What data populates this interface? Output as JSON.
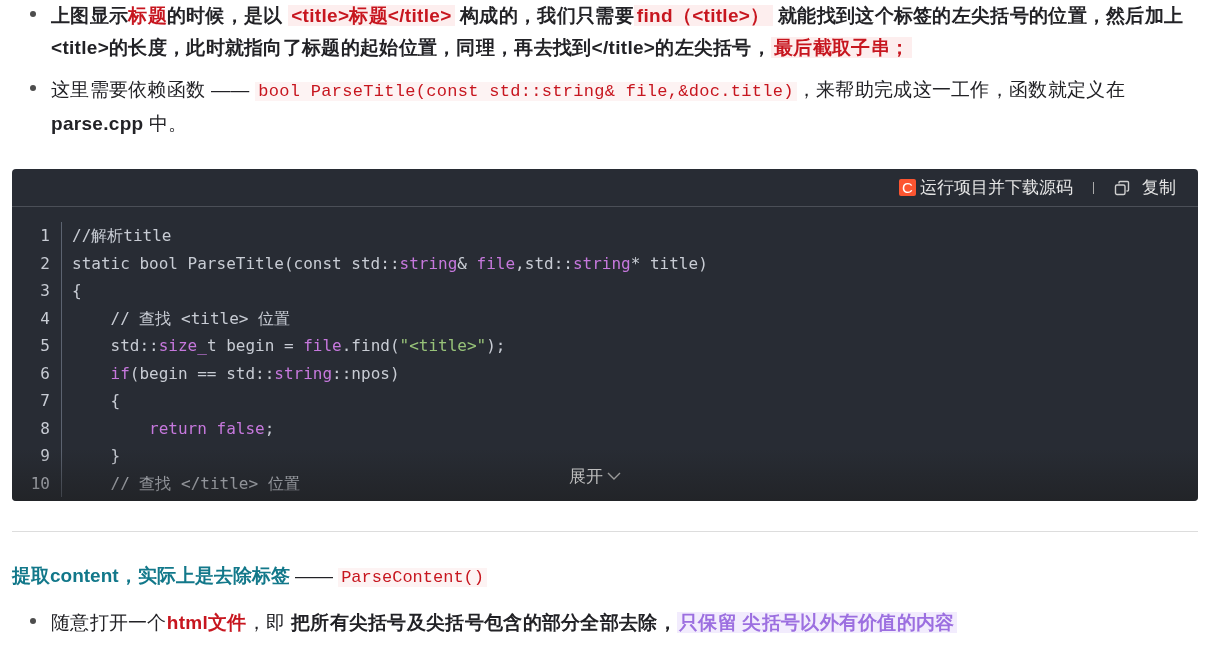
{
  "bullets_top": [
    {
      "segments": [
        {
          "kind": "bold",
          "text": "上图显示"
        },
        {
          "kind": "red",
          "text": "标题"
        },
        {
          "kind": "bold",
          "text": "的时候，是以 "
        },
        {
          "kind": "mark",
          "text": "<title>标题</title>"
        },
        {
          "kind": "bold",
          "text": " 构成的，我们只需要"
        },
        {
          "kind": "mark",
          "text": "find（<title>）"
        },
        {
          "kind": "bold",
          "text": " 就能找到这个标签的左尖括号的位置，然后加上<title>的长度，此时就指向了标题的起始位置，同理，再去找到</title>的左尖括号，"
        },
        {
          "kind": "mark",
          "text": "最后截取子串； "
        }
      ]
    },
    {
      "segments": [
        {
          "kind": "plain",
          "text": "这里需要依赖函数 —— "
        },
        {
          "kind": "code",
          "text": "bool ParseTitle(const std::string& file,&doc.title)"
        },
        {
          "kind": "plain",
          "text": "，来帮助完成这一工作，函数就定义在 "
        },
        {
          "kind": "bold",
          "text": "parse.cpp"
        },
        {
          "kind": "plain",
          "text": " 中。"
        }
      ]
    }
  ],
  "code_block": {
    "logo": "C",
    "run_button": "运行项目并下载源码",
    "copy_button": "复制",
    "expand_button": "展开",
    "lines": [
      {
        "number": "1",
        "tokens": [
          {
            "kind": "plain",
            "text": "//解析title"
          }
        ]
      },
      {
        "number": "2",
        "tokens": [
          {
            "kind": "plain",
            "text": "static bool ParseTitle(const std::"
          },
          {
            "kind": "keyword",
            "text": "string"
          },
          {
            "kind": "plain",
            "text": "& "
          },
          {
            "kind": "keyword",
            "text": "file"
          },
          {
            "kind": "plain",
            "text": ",std::"
          },
          {
            "kind": "keyword",
            "text": "string"
          },
          {
            "kind": "plain",
            "text": "* title)"
          }
        ]
      },
      {
        "number": "3",
        "tokens": [
          {
            "kind": "plain",
            "text": "{"
          }
        ]
      },
      {
        "number": "4",
        "tokens": [
          {
            "kind": "plain",
            "text": "    // 查找 <title> 位置"
          }
        ]
      },
      {
        "number": "5",
        "tokens": [
          {
            "kind": "plain",
            "text": "    std::"
          },
          {
            "kind": "keyword",
            "text": "size_"
          },
          {
            "kind": "plain",
            "text": "t begin = "
          },
          {
            "kind": "keyword",
            "text": "file"
          },
          {
            "kind": "plain",
            "text": ".find("
          },
          {
            "kind": "string",
            "text": "\"<title>\""
          },
          {
            "kind": "plain",
            "text": ");"
          }
        ]
      },
      {
        "number": "6",
        "tokens": [
          {
            "kind": "keyword",
            "text": "    if"
          },
          {
            "kind": "plain",
            "text": "(begin == std::"
          },
          {
            "kind": "keyword",
            "text": "string"
          },
          {
            "kind": "plain",
            "text": "::npos)"
          }
        ]
      },
      {
        "number": "7",
        "tokens": [
          {
            "kind": "plain",
            "text": "    {"
          }
        ]
      },
      {
        "number": "8",
        "tokens": [
          {
            "kind": "keyword",
            "text": "        return false"
          },
          {
            "kind": "plain",
            "text": ";"
          }
        ]
      },
      {
        "number": "9",
        "tokens": [
          {
            "kind": "plain",
            "text": "    }"
          }
        ]
      },
      {
        "number": "10",
        "tokens": [
          {
            "kind": "plain",
            "text": "    // 查找 </title> 位置"
          }
        ]
      }
    ]
  },
  "heading": {
    "segments": [
      {
        "kind": "teal",
        "text": "提取content，实际上是去除标签"
      },
      {
        "kind": "plain",
        "text": " —— "
      },
      {
        "kind": "code",
        "text": "ParseContent()"
      }
    ]
  },
  "bullets_bottom": [
    {
      "segments": [
        {
          "kind": "plain",
          "text": "随意打开一个"
        },
        {
          "kind": "red",
          "text": "html文件"
        },
        {
          "kind": "plain",
          "text": "，即 "
        },
        {
          "kind": "bold",
          "text": "把所有尖括号及尖括号包含的部分全部去除，"
        },
        {
          "kind": "purple",
          "text": "只保留 尖括号以外有价值的内容"
        }
      ]
    }
  ]
}
